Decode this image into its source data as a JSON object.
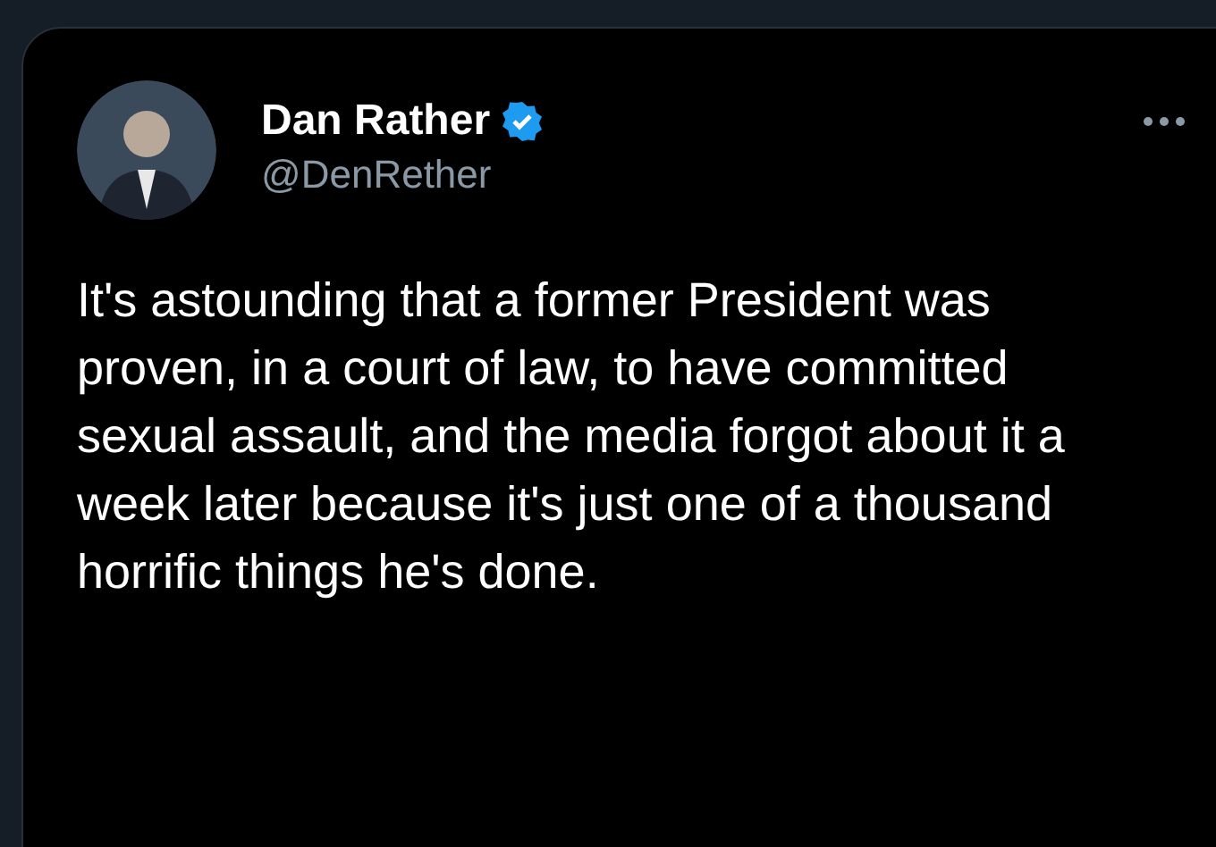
{
  "author": {
    "name": "Dan Rather",
    "verified": true,
    "handle": "@DenRether"
  },
  "text": "It's astounding that a former President was proven, in a court of law, to have committed sexual assault, and the media forgot about it a week later because it's just one of a thousand horrific things he's done."
}
